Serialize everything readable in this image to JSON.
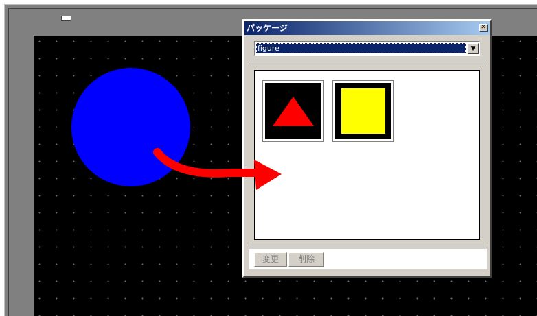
{
  "package_window": {
    "title": "パッケージ",
    "close_glyph": "✕",
    "dropdown": {
      "selected": "figure",
      "arrow_glyph": "▼"
    },
    "items": [
      {
        "name": "triangle",
        "color": "#ff0000"
      },
      {
        "name": "square",
        "color": "#ffff00"
      }
    ],
    "buttons": {
      "change_label": "変更",
      "delete_label": "削除"
    }
  },
  "canvas": {
    "circle_color": "#0000ff",
    "arrow_color": "#ff0000",
    "background": "#000000"
  },
  "colors": {
    "titlebar_start": "#0a246a",
    "titlebar_end": "#a6caf0",
    "window_face": "#d4d0c8"
  }
}
